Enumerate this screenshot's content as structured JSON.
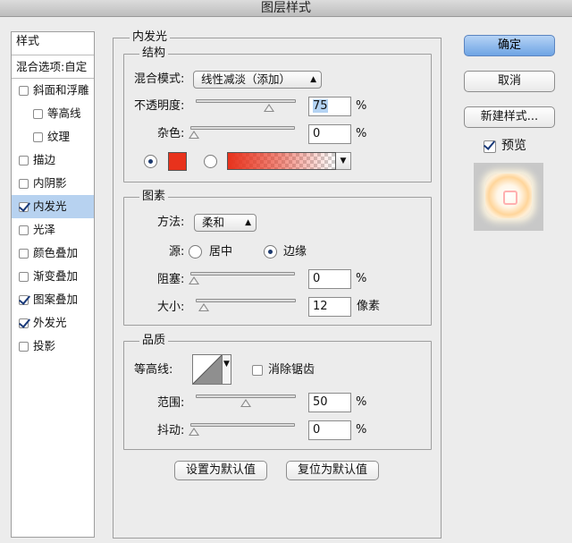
{
  "window": {
    "title": "图层样式"
  },
  "sidebar": {
    "header": "样式",
    "blend_options": "混合选项:自定",
    "items": [
      {
        "label": "斜面和浮雕",
        "checked": false,
        "sub": false,
        "selected": false
      },
      {
        "label": "等高线",
        "checked": false,
        "sub": true,
        "selected": false
      },
      {
        "label": "纹理",
        "checked": false,
        "sub": true,
        "selected": false
      },
      {
        "label": "描边",
        "checked": false,
        "sub": false,
        "selected": false
      },
      {
        "label": "内阴影",
        "checked": false,
        "sub": false,
        "selected": false
      },
      {
        "label": "内发光",
        "checked": true,
        "sub": false,
        "selected": true
      },
      {
        "label": "光泽",
        "checked": false,
        "sub": false,
        "selected": false
      },
      {
        "label": "颜色叠加",
        "checked": false,
        "sub": false,
        "selected": false
      },
      {
        "label": "渐变叠加",
        "checked": false,
        "sub": false,
        "selected": false
      },
      {
        "label": "图案叠加",
        "checked": true,
        "sub": false,
        "selected": false
      },
      {
        "label": "外发光",
        "checked": true,
        "sub": false,
        "selected": false
      },
      {
        "label": "投影",
        "checked": false,
        "sub": false,
        "selected": false
      }
    ]
  },
  "panel": {
    "title": "内发光",
    "structure": {
      "legend": "结构",
      "blend_mode_label": "混合模式:",
      "blend_mode_value": "线性减淡（添加）",
      "opacity_label": "不透明度:",
      "opacity_value": "75",
      "opacity_fraction": 0.75,
      "noise_label": "杂色:",
      "noise_value": "0",
      "noise_fraction": 0,
      "percent": "%",
      "color_mode": "solid",
      "glow_color": "#e8321c"
    },
    "elements": {
      "legend": "图素",
      "method_label": "方法:",
      "method_value": "柔和",
      "source_label": "源:",
      "source_center": "居中",
      "source_edge": "边缘",
      "source_selected": "edge",
      "choke_label": "阻塞:",
      "choke_value": "0",
      "choke_fraction": 0,
      "size_label": "大小:",
      "size_value": "12",
      "size_fraction": 0.05,
      "pixels": "像素",
      "percent": "%"
    },
    "quality": {
      "legend": "品质",
      "contour_label": "等高线:",
      "antialias_label": "消除锯齿",
      "antialias_checked": false,
      "range_label": "范围:",
      "range_value": "50",
      "range_fraction": 0.5,
      "jitter_label": "抖动:",
      "jitter_value": "0",
      "jitter_fraction": 0,
      "percent": "%"
    },
    "buttons": {
      "make_default": "设置为默认值",
      "reset_default": "复位为默认值"
    }
  },
  "actions": {
    "ok": "确定",
    "cancel": "取消",
    "new_style": "新建样式...",
    "preview_label": "预览",
    "preview_checked": true
  }
}
